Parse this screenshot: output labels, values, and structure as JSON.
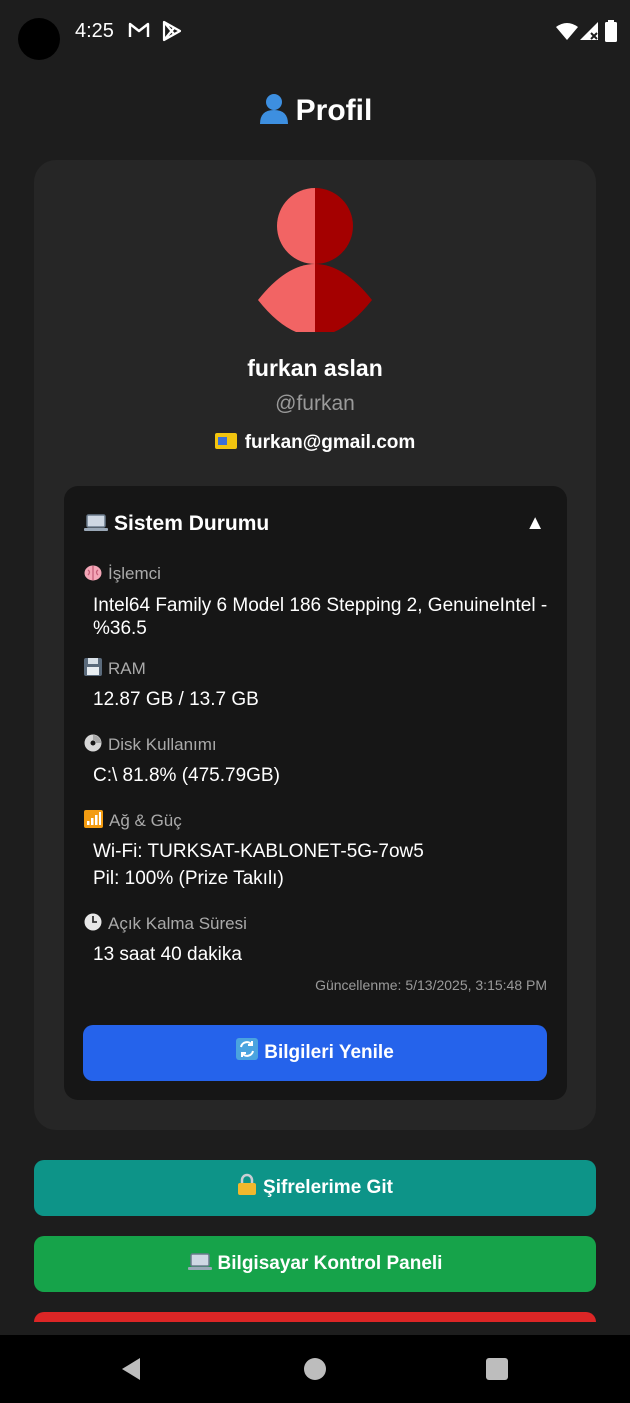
{
  "status_bar": {
    "time": "4:25",
    "icons": [
      "gmail-icon",
      "play-store-icon",
      "wifi-icon",
      "signal-icon",
      "battery-icon"
    ]
  },
  "page": {
    "title": "Profil",
    "title_icon": "person-silhouette-icon"
  },
  "profile": {
    "name": "furkan aslan",
    "handle": "@furkan",
    "email": "furkan@gmail.com",
    "email_icon": "email-icon",
    "avatar_colors": {
      "left": "#f26464",
      "right": "#a40000"
    }
  },
  "system": {
    "title": "Sistem Durumu",
    "title_icon": "laptop-icon",
    "toggle": "▲",
    "cpu": {
      "label": "İşlemci",
      "icon": "brain-icon",
      "value": "Intel64 Family 6 Model 186 Stepping 2, GenuineIntel - %36.5"
    },
    "ram": {
      "label": "RAM",
      "icon": "floppy-icon",
      "value": "12.87 GB / 13.7 GB"
    },
    "disk": {
      "label": "Disk Kullanımı",
      "icon": "disc-icon",
      "value": "C:\\ 81.8% (475.79GB)"
    },
    "network": {
      "label": "Ağ & Güç",
      "icon": "signal-bars-icon",
      "wifi": "Wi-Fi: TURKSAT-KABLONET-5G-7ow5",
      "battery": "Pil: 100% (Prize Takılı)"
    },
    "uptime": {
      "label": "Açık Kalma Süresi",
      "icon": "clock-icon",
      "value": "13 saat 40 dakika"
    },
    "updated": "Güncellenme: 5/13/2025, 3:15:48 PM",
    "refresh_label": "Bilgileri Yenile",
    "refresh_icon": "refresh-icon"
  },
  "actions": {
    "passwords_label": "Şifrelerime Git",
    "passwords_icon": "lock-icon",
    "control_label": "Bilgisayar Kontrol Paneli",
    "control_icon": "laptop-icon"
  },
  "colors": {
    "background": "#1d1d1d",
    "card": "#262626",
    "panel": "#161616",
    "blue": "#2563eb",
    "teal": "#0d9488",
    "green": "#16a34a",
    "red": "#dc2626"
  }
}
